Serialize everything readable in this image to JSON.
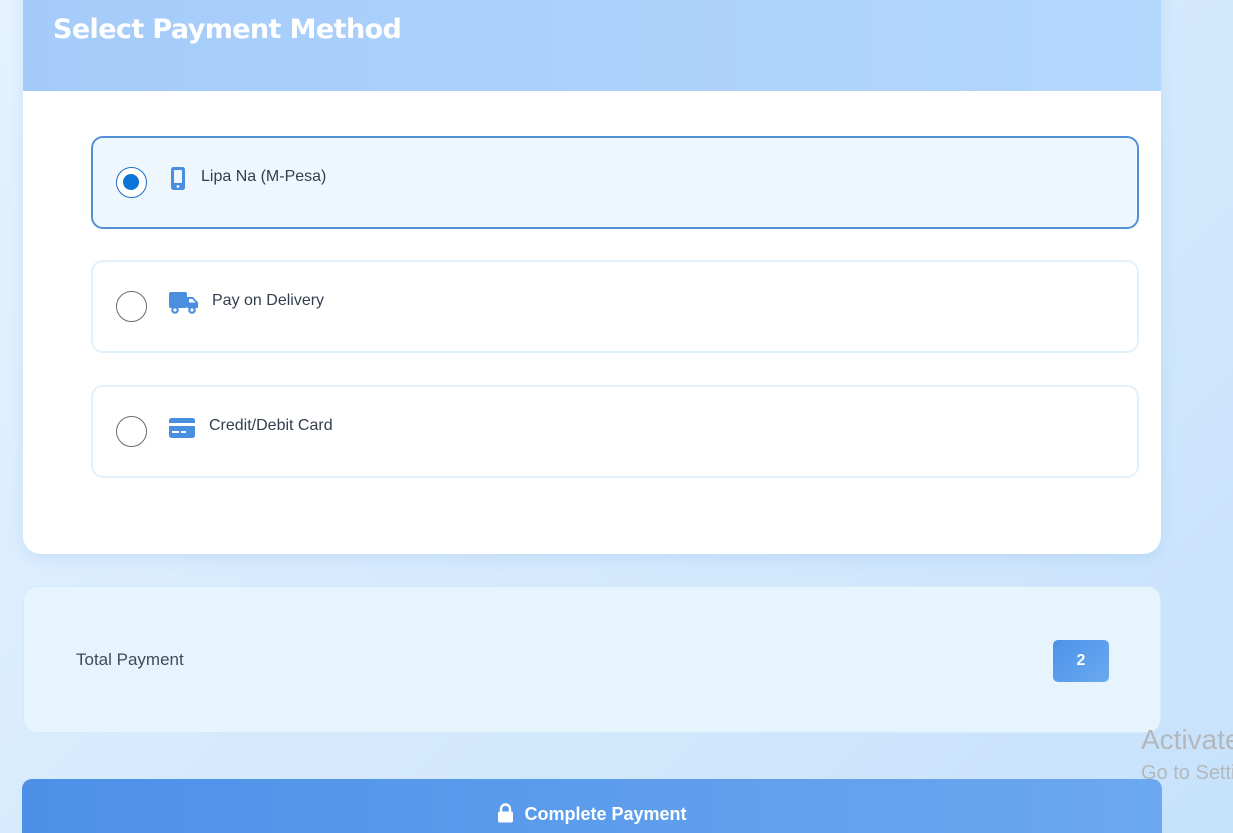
{
  "header": {
    "title": "Select Payment Method"
  },
  "payment_options": [
    {
      "label": "Lipa Na (M-Pesa)",
      "icon": "mobile-phone-icon",
      "selected": true
    },
    {
      "label": "Pay on Delivery",
      "icon": "delivery-truck-icon",
      "selected": false
    },
    {
      "label": "Credit/Debit Card",
      "icon": "credit-card-icon",
      "selected": false
    }
  ],
  "summary": {
    "total_label": "Total Payment",
    "total_value": "2"
  },
  "actions": {
    "complete_label": "Complete Payment",
    "complete_icon": "lock-icon"
  },
  "watermark": {
    "line1": "Activate",
    "line2": "Go to Settings"
  },
  "colors": {
    "accent": "#4d90e8",
    "selected_radio": "#0a75d6",
    "icon": "#4a8ee0"
  }
}
